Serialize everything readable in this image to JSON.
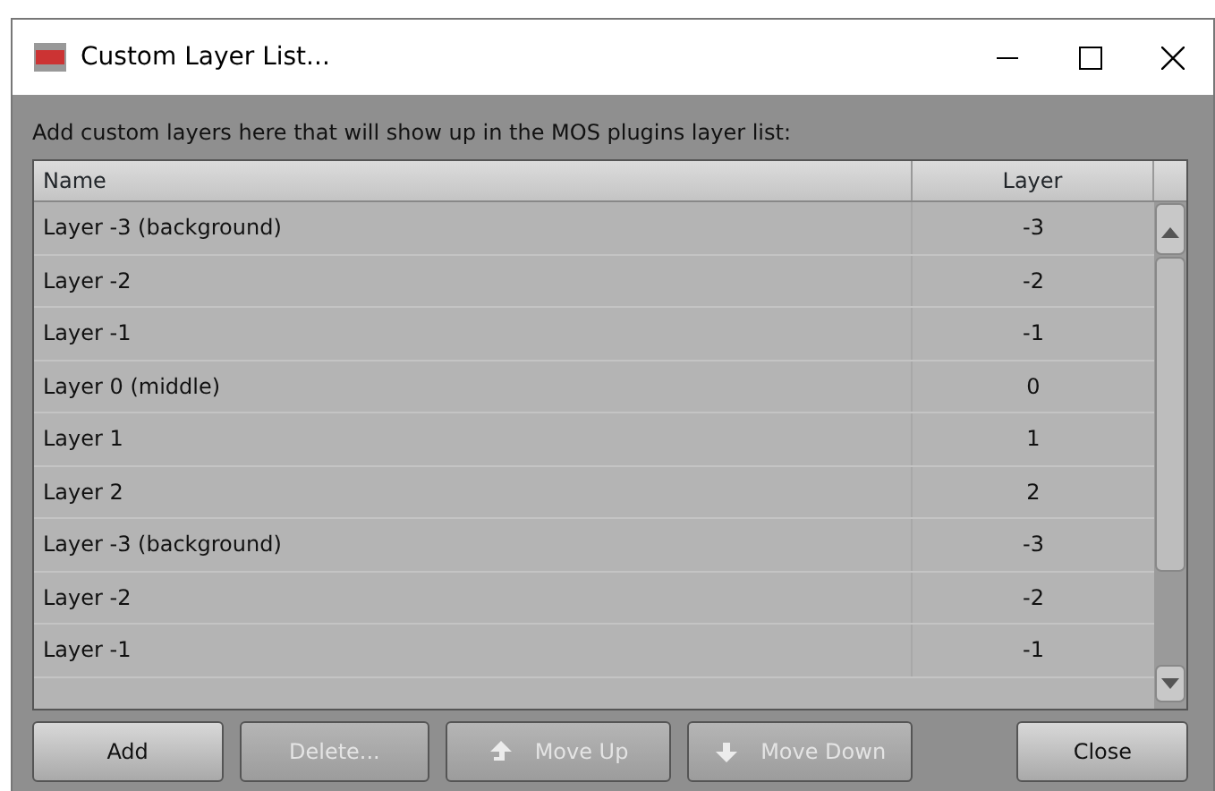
{
  "window": {
    "title": "Custom Layer List..."
  },
  "instruction": "Add custom layers here that will show up in the MOS plugins layer list:",
  "table": {
    "columns": [
      "Name",
      "Layer"
    ],
    "rows": [
      {
        "name": "Layer -3 (background)",
        "layer": "-3"
      },
      {
        "name": "Layer -2",
        "layer": "-2"
      },
      {
        "name": "Layer -1",
        "layer": "-1"
      },
      {
        "name": "Layer 0 (middle)",
        "layer": "0"
      },
      {
        "name": "Layer 1",
        "layer": "1"
      },
      {
        "name": "Layer 2",
        "layer": "2"
      },
      {
        "name": "Layer -3 (background)",
        "layer": "-3"
      },
      {
        "name": "Layer -2",
        "layer": "-2"
      },
      {
        "name": "Layer -1",
        "layer": "-1"
      }
    ]
  },
  "buttons": [
    {
      "label": "Add",
      "kind": "plain",
      "disabled": false
    },
    {
      "label": "Delete...",
      "kind": "plain",
      "disabled": true
    },
    {
      "label": "Move Up",
      "kind": "up",
      "disabled": true
    },
    {
      "label": "Move Down",
      "kind": "down",
      "disabled": true
    },
    {
      "label": "Close",
      "kind": "plain",
      "disabled": false
    }
  ]
}
